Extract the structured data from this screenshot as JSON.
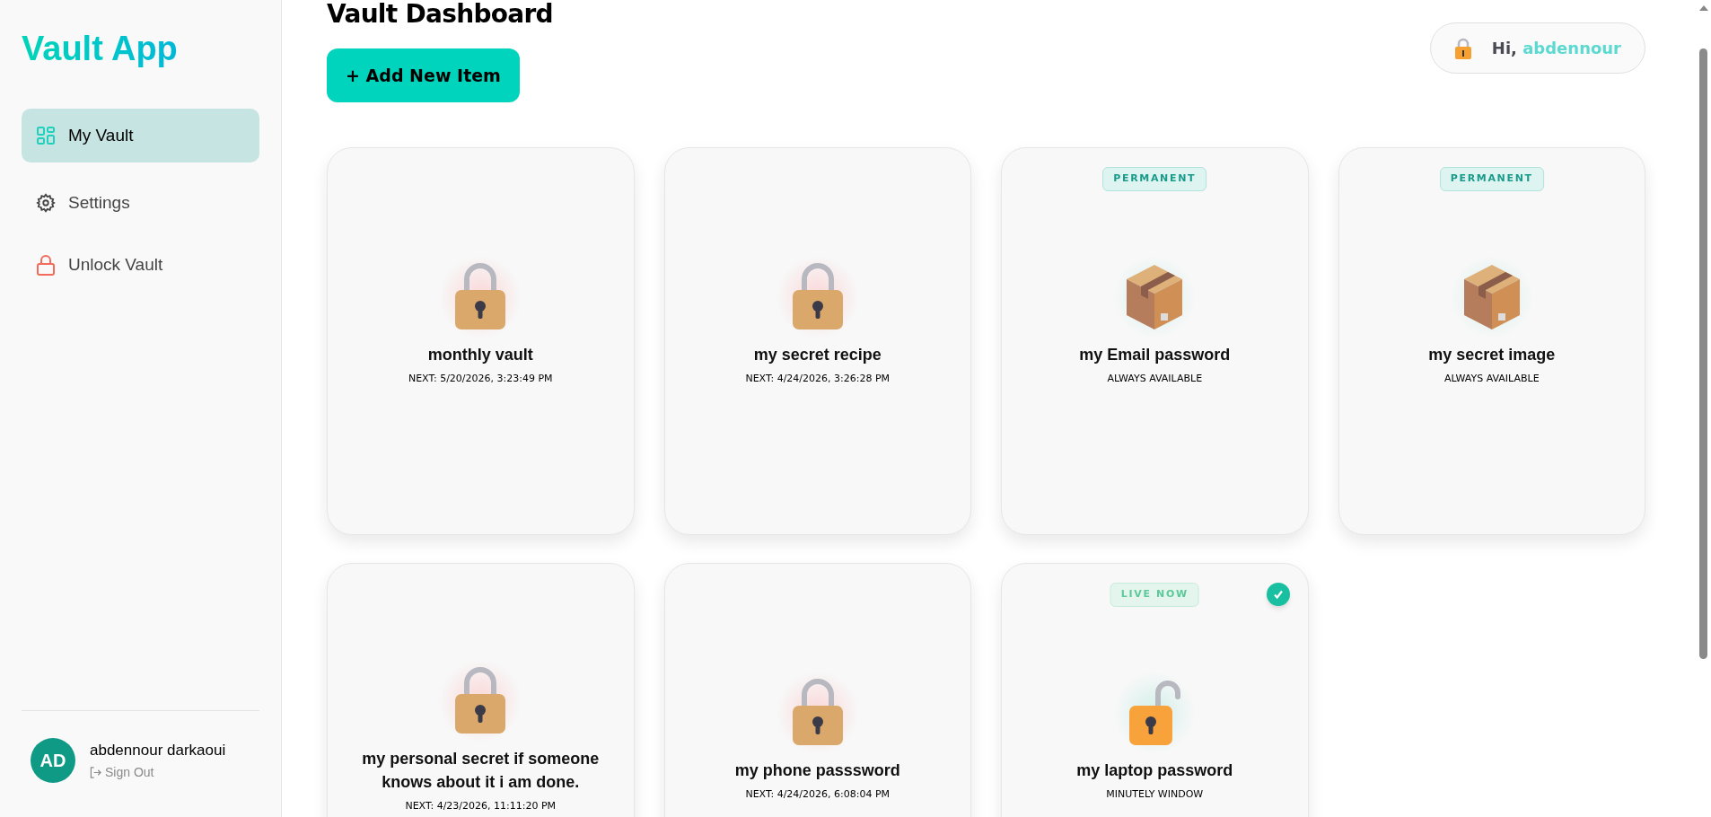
{
  "sidebar": {
    "logo": "Vault App",
    "items": [
      {
        "kind": "grid",
        "label": "My Vault",
        "selected": true
      },
      {
        "kind": "gear",
        "label": "Settings",
        "selected": false
      },
      {
        "kind": "lock",
        "label": "Unlock Vault",
        "selected": false
      }
    ],
    "user": {
      "initials": "AD",
      "name": "abdennour darkaoui",
      "sign_out": "Sign Out"
    }
  },
  "header": {
    "title": "Vault Dashboard",
    "add_button": "+ Add New Item",
    "greeting": "Hi,",
    "username": "abdennour"
  },
  "items": [
    {
      "kind": "locked",
      "title": "monthly vault",
      "subtitle": "NEXT: 5/20/2026, 3:23:49 PM",
      "verified": false
    },
    {
      "kind": "locked",
      "title": "my secret recipe",
      "subtitle": "NEXT: 4/24/2026, 3:26:28 PM",
      "verified": false
    },
    {
      "kind": "permanent",
      "badge": "PERMANENT",
      "title": "my Email password",
      "subtitle": "ALWAYS AVAILABLE",
      "verified": false
    },
    {
      "kind": "permanent",
      "badge": "PERMANENT",
      "title": "my secret image",
      "subtitle": "ALWAYS AVAILABLE",
      "verified": false
    },
    {
      "kind": "locked",
      "title": "my personal secret if someone knows about it i am done.",
      "subtitle": "NEXT: 4/23/2026, 11:11:20 PM",
      "verified": false
    },
    {
      "kind": "locked",
      "title": "my phone passsword",
      "subtitle": "NEXT: 4/24/2026, 6:08:04 PM",
      "verified": false
    },
    {
      "kind": "live",
      "badge": "LIVE NOW",
      "title": "my laptop password",
      "subtitle": "MINUTELY WINDOW",
      "verified": true
    }
  ]
}
